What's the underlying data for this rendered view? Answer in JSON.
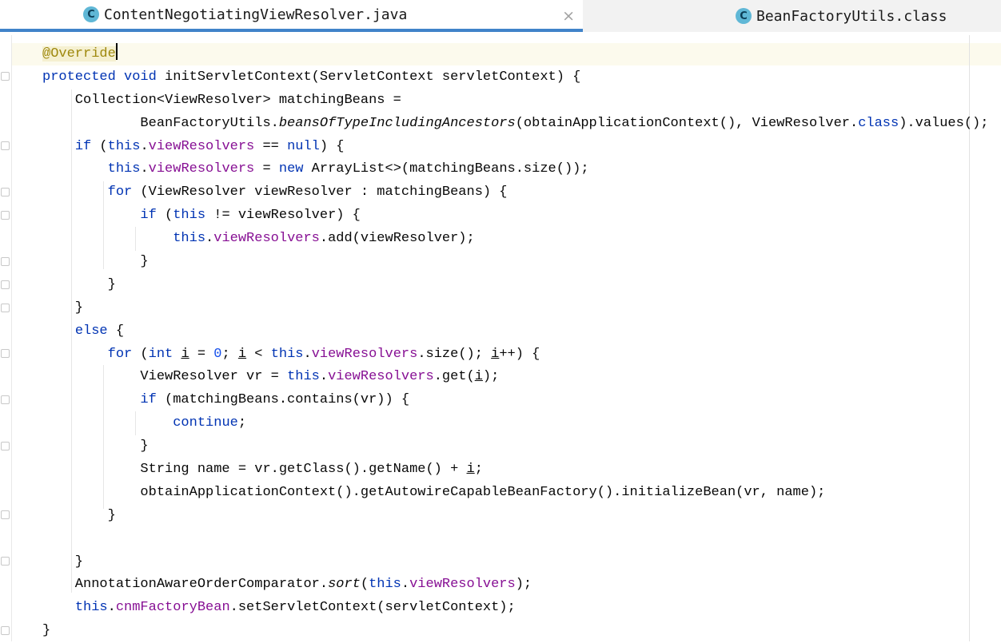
{
  "tabs": [
    {
      "icon": "C",
      "label": "ContentNegotiatingViewResolver.java",
      "active": true
    },
    {
      "icon": "C",
      "label": "BeanFactoryUtils.class",
      "active": false
    }
  ],
  "close_symbol": "×",
  "code": {
    "l1": {
      "t0": "@Override"
    },
    "l2": {
      "t0": "protected",
      "t1": " ",
      "t2": "void",
      "t3": " initServletContext(ServletContext servletContext) {"
    },
    "l3": {
      "t0": "    Collection<ViewResolver> matchingBeans ="
    },
    "l4": {
      "t0": "            BeanFactoryUtils.",
      "t1": "beansOfTypeIncludingAncestors",
      "t2": "(obtainApplicationContext(), ViewResolver.",
      "t3": "class",
      "t4": ").values();"
    },
    "l5": {
      "t0": "    ",
      "t1": "if",
      "t2": " (",
      "t3": "this",
      "t4": ".",
      "t5": "viewResolvers",
      "t6": " == ",
      "t7": "null",
      "t8": ") {"
    },
    "l6": {
      "t0": "        ",
      "t1": "this",
      "t2": ".",
      "t3": "viewResolvers",
      "t4": " = ",
      "t5": "new",
      "t6": " ArrayList<>(matchingBeans.size());"
    },
    "l7": {
      "t0": "        ",
      "t1": "for",
      "t2": " (ViewResolver viewResolver : matchingBeans) {"
    },
    "l8": {
      "t0": "            ",
      "t1": "if",
      "t2": " (",
      "t3": "this",
      "t4": " != viewResolver) {"
    },
    "l9": {
      "t0": "                ",
      "t1": "this",
      "t2": ".",
      "t3": "viewResolvers",
      "t4": ".add(viewResolver);"
    },
    "l10": {
      "t0": "            }"
    },
    "l11": {
      "t0": "        }"
    },
    "l12": {
      "t0": "    }"
    },
    "l13": {
      "t0": "    ",
      "t1": "else",
      "t2": " {"
    },
    "l14": {
      "t0": "        ",
      "t1": "for",
      "t2": " (",
      "t3": "int",
      "t4": " ",
      "t5": "i",
      "t6": " = ",
      "t7": "0",
      "t8": "; ",
      "t9": "i",
      "t10": " < ",
      "t11": "this",
      "t12": ".",
      "t13": "viewResolvers",
      "t14": ".size(); ",
      "t15": "i",
      "t16": "++) {"
    },
    "l15": {
      "t0": "            ViewResolver vr = ",
      "t1": "this",
      "t2": ".",
      "t3": "viewResolvers",
      "t4": ".get(",
      "t5": "i",
      "t6": ");"
    },
    "l16": {
      "t0": "            ",
      "t1": "if",
      "t2": " (matchingBeans.contains(vr)) {"
    },
    "l17": {
      "t0": "                ",
      "t1": "continue",
      "t2": ";"
    },
    "l18": {
      "t0": "            }"
    },
    "l19": {
      "t0": "            String name = vr.getClass().getName() + ",
      "t1": "i",
      "t2": ";"
    },
    "l20": {
      "t0": "            obtainApplicationContext().getAutowireCapableBeanFactory().initializeBean(vr, name);"
    },
    "l21": {
      "t0": "        }"
    },
    "l22": {
      "t0": ""
    },
    "l23": {
      "t0": "    }"
    },
    "l24": {
      "t0": "    AnnotationAwareOrderComparator.",
      "t1": "sort",
      "t2": "(",
      "t3": "this",
      "t4": ".",
      "t5": "viewResolvers",
      "t6": ");"
    },
    "l25": {
      "t0": "    ",
      "t1": "this",
      "t2": ".",
      "t3": "cnmFactoryBean",
      "t4": ".setServletContext(servletContext);"
    },
    "l26": {
      "t0": "}"
    }
  },
  "colors": {
    "keyword": "#0033b3",
    "field": "#871094",
    "annotation": "#9e880d",
    "number": "#1750eb",
    "tab_accent": "#4083c9"
  }
}
